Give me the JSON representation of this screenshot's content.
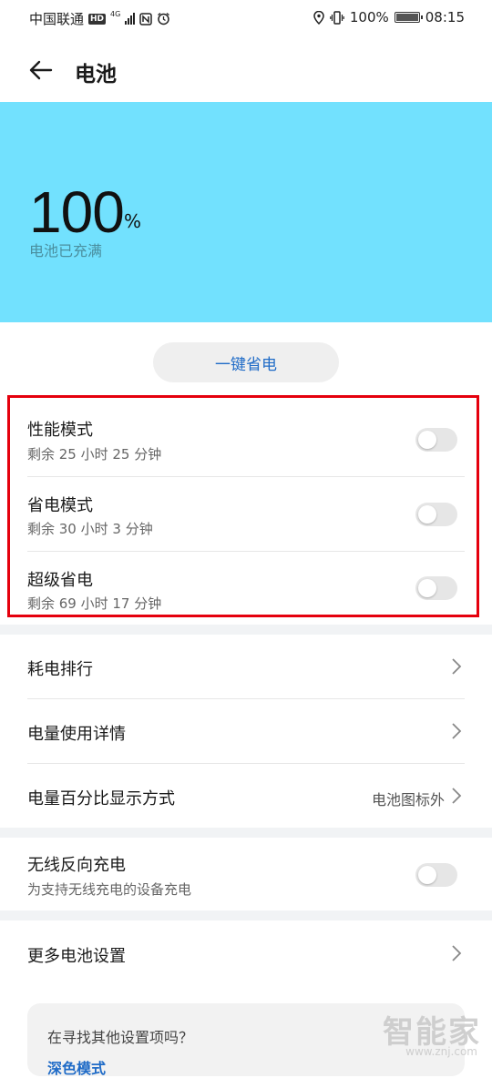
{
  "status_bar": {
    "carrier": "中国联通",
    "hd_badge": "HD",
    "network": "4G",
    "battery_text": "100%",
    "time": "08:15"
  },
  "header": {
    "title": "电池"
  },
  "battery": {
    "percent_value": "100",
    "percent_sign": "%",
    "status": "电池已充满",
    "hero_color": "#72e1fe"
  },
  "one_key_save": {
    "label": "一键省电"
  },
  "power_modes": [
    {
      "label": "性能模式",
      "remaining": "剩余 25 小时 25 分钟",
      "enabled": false
    },
    {
      "label": "省电模式",
      "remaining": "剩余 30 小时 3 分钟",
      "enabled": false
    },
    {
      "label": "超级省电",
      "remaining": "剩余 69 小时 17 分钟",
      "enabled": false
    }
  ],
  "menu": {
    "consumption_rank": "耗电排行",
    "usage_details": "电量使用详情",
    "percent_display": {
      "label": "电量百分比显示方式",
      "value": "电池图标外"
    },
    "wireless_reverse": {
      "label": "无线反向充电",
      "sub": "为支持无线充电的设备充电",
      "enabled": false
    },
    "more_settings": "更多电池设置"
  },
  "search_card": {
    "question": "在寻找其他设置项吗？",
    "link": "深色模式"
  },
  "watermark": {
    "brand": "智能家",
    "url": "www.znj.com"
  },
  "colors": {
    "accent": "#1f6bc7",
    "highlight_box": "#e5000d"
  }
}
